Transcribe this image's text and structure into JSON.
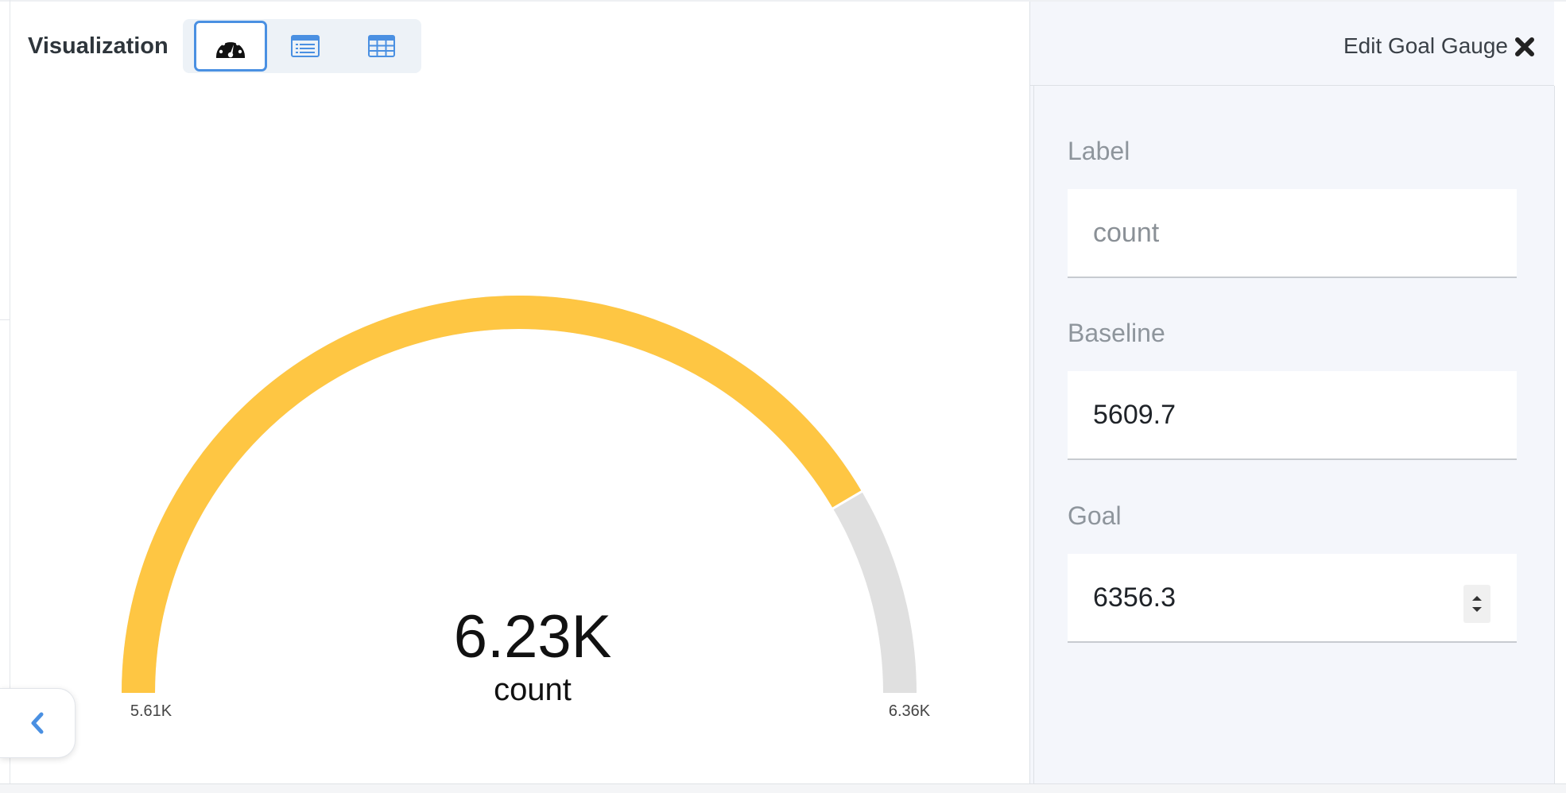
{
  "visualization": {
    "title": "Visualization",
    "types": [
      {
        "name": "gauge",
        "icon": "gauge-icon",
        "selected": true
      },
      {
        "name": "list",
        "icon": "list-icon",
        "selected": false
      },
      {
        "name": "table",
        "icon": "table-icon",
        "selected": false
      }
    ]
  },
  "gauge": {
    "value_text": "6.23K",
    "label": "count",
    "min_label": "5.61K",
    "max_label": "6.36K",
    "baseline": 5609.7,
    "goal": 6356.3,
    "current": 6230,
    "colors": {
      "fill": "#fec643",
      "track": "#e0e0e0"
    }
  },
  "sidebar": {
    "title": "Edit Goal Gauge",
    "close_icon": "close-icon",
    "fields": {
      "label": {
        "label": "Label",
        "placeholder": "count",
        "value": ""
      },
      "baseline": {
        "label": "Baseline",
        "value": "5609.7"
      },
      "goal": {
        "label": "Goal",
        "value": "6356.3"
      }
    }
  },
  "collapse": {
    "icon": "chevron-left-icon"
  },
  "colors": {
    "accent": "#4a90e2"
  }
}
